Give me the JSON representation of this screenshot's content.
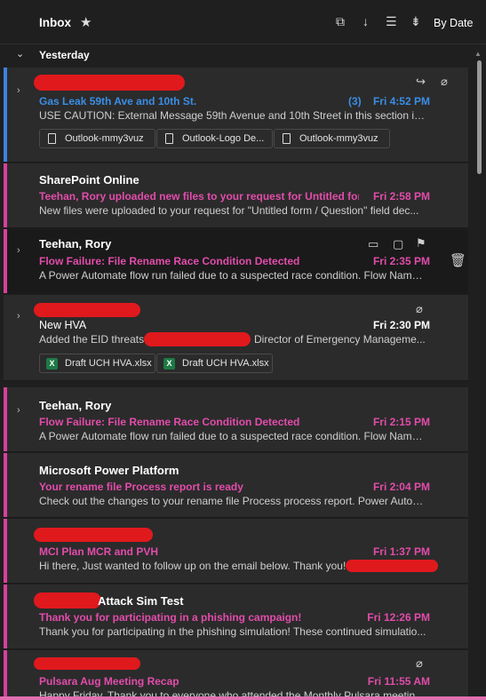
{
  "colors": {
    "blue": "#3a8ee6",
    "pink": "#e24cab",
    "accent_bar_blue": "#3b82e0",
    "accent_bar_pink": "#d83f9c",
    "redaction": "#e0191d"
  },
  "header": {
    "title": "Inbox",
    "sort_label": "By Date"
  },
  "group": {
    "label": "Yesterday"
  },
  "messages": [
    {
      "sender": "",
      "subject": "Gas Leak 59th Ave and 10th St.",
      "count": "(3)",
      "time": "Fri 4:52 PM",
      "preview": "USE CAUTION: External Message 59th Avenue and 10th Street in this section is no...",
      "attachments": [
        "Outlook-mmy3vuz",
        "Outlook-Logo De...",
        "Outlook-mmy3vuz"
      ]
    },
    {
      "sender": "SharePoint Online",
      "subject": "Teehan, Rory uploaded new files to your request for Untitled for...",
      "time": "Fri 2:58 PM",
      "preview": "New files were uploaded to your request for \"Untitled form / Question\" field dec..."
    },
    {
      "sender": "Teehan, Rory",
      "subject": "Flow Failure: File Rename Race Condition Detected",
      "time": "Fri 2:35 PM",
      "preview": "A Power Automate flow run failed due to a suspected race condition. Flow Name:..."
    },
    {
      "sender": "",
      "subject": "New HVA",
      "time": "Fri 2:30 PM",
      "preview": "Added the EID threats",
      "preview_tail": "Director of Emergency Manageme...",
      "attachments": [
        "Draft UCH HVA.xlsx",
        "Draft UCH HVA.xlsx"
      ]
    },
    {
      "sender": "Teehan, Rory",
      "subject": "Flow Failure: File Rename Race Condition Detected",
      "time": "Fri 2:15 PM",
      "preview": "A Power Automate flow run failed due to a suspected race condition. Flow Name:..."
    },
    {
      "sender": "Microsoft Power Platform",
      "subject": "Your rename file Process report is ready",
      "time": "Fri 2:04 PM",
      "preview": "Check out the changes to your rename file Process process report. Power Automa..."
    },
    {
      "sender": "",
      "subject": "MCI Plan MCR and PVH",
      "time": "Fri 1:37 PM",
      "preview": "Hi there, Just wanted to follow up on the email below. Thank you!"
    },
    {
      "sender": "Attack Sim Test",
      "subject": "Thank you for participating in a phishing campaign!",
      "time": "Fri 12:26 PM",
      "preview": "Thank you for participating in the phishing simulation! These continued simulatio..."
    },
    {
      "sender": "",
      "subject": "Pulsara Aug Meeting Recap",
      "time": "Fri 11:55 AM",
      "preview": "Happy Friday, Thank you to everyone who attended the Monthly Pulsara meeting..."
    }
  ]
}
